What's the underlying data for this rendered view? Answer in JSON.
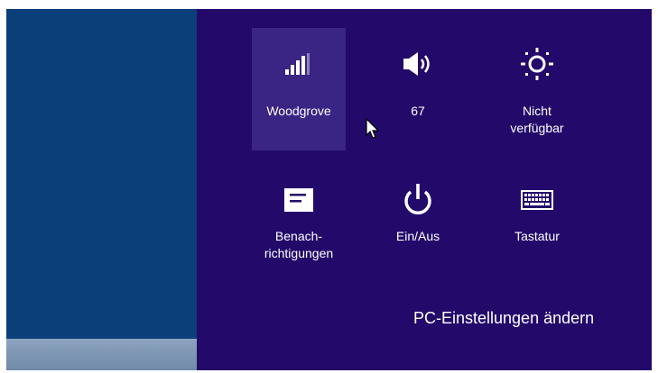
{
  "settings_charm": {
    "tiles": [
      {
        "label": "Woodgrove",
        "icon": "signal-bars-icon",
        "active": true
      },
      {
        "label": "67",
        "icon": "speaker-volume-icon"
      },
      {
        "label": "Nicht verfügbar",
        "icon": "brightness-sun-icon"
      },
      {
        "label": "Benach-richtigungen",
        "icon": "notifications-icon"
      },
      {
        "label": "Ein/Aus",
        "icon": "power-icon"
      },
      {
        "label": "Tastatur",
        "icon": "keyboard-icon"
      }
    ],
    "labels": {
      "network": "Woodgrove",
      "volume": "67",
      "brightness_line1": "Nicht",
      "brightness_line2": "verfügbar",
      "notifications_line1": "Benach-",
      "notifications_line2": "richtigungen",
      "power": "Ein/Aus",
      "keyboard": "Tastatur"
    },
    "change_pc_settings": "PC-Einstellungen ändern"
  },
  "colors": {
    "desktop": "#0b3f7a",
    "charm_background": "#230a6a",
    "active_tile": "#3a2484"
  }
}
